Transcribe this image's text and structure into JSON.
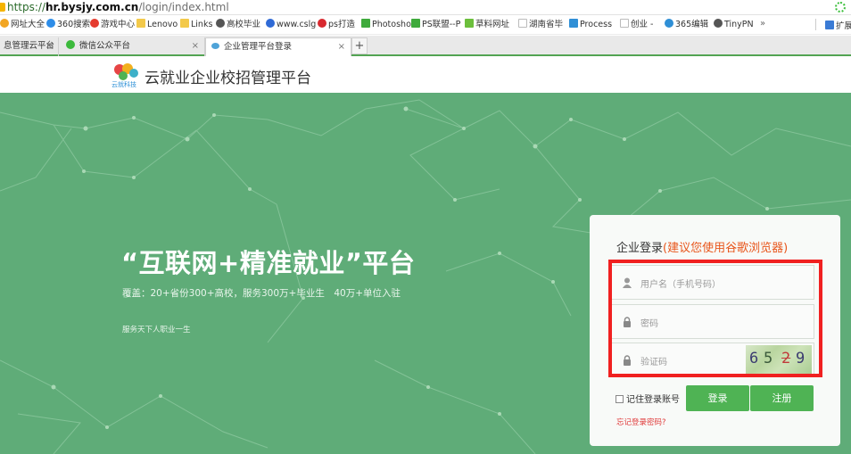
{
  "browser": {
    "url_scheme": "https://",
    "url_host": "hr.bysjy.com.cn",
    "url_path": "/login/index.html"
  },
  "bookmarks": [
    {
      "label": "网址大全",
      "color": "#f2a623"
    },
    {
      "label": "360搜索",
      "color": "#2e8de8"
    },
    {
      "label": "游戏中心",
      "color": "#e53b2f"
    },
    {
      "label": "Lenovo",
      "color": "#f3c94a"
    },
    {
      "label": "Links",
      "color": "#f3c94a"
    },
    {
      "label": "高校毕业",
      "color": "#555555"
    },
    {
      "label": "www.cslg",
      "color": "#2f6ad6"
    },
    {
      "label": "ps打造",
      "color": "#d8292f"
    },
    {
      "label": "Photosho",
      "color": "#3faa3c"
    },
    {
      "label": "PS联盟--P",
      "color": "#3faa3c"
    },
    {
      "label": "草料网址",
      "color": "#6cbf3c"
    },
    {
      "label": "湖南省毕",
      "color": "#bbbbbb"
    },
    {
      "label": "Process",
      "color": "#2f8fd6"
    },
    {
      "label": "创业 -",
      "color": "#bbbbbb"
    },
    {
      "label": "365编辑",
      "color": "#2f8fd6"
    },
    {
      "label": "TinyPN",
      "color": "#555555"
    }
  ],
  "bookmarks_more": "»",
  "bookmarks_right": "扩展",
  "tabs": [
    {
      "label": "息管理云平台",
      "active": false
    },
    {
      "label": "微信公众平台",
      "active": false
    },
    {
      "label": "企业管理平台登录",
      "active": true
    }
  ],
  "tab_close": "×",
  "tab_new": "+",
  "site": {
    "logo_text": "云就科技",
    "title": "云就业企业校招管理平台"
  },
  "hero": {
    "title": "“互联网+精准就业”平台",
    "subtitle": "覆盖：20+省份300+高校，服务300万+毕业生　40万+单位入驻",
    "motto": "服务天下人职业一生"
  },
  "login": {
    "title": "企业登录",
    "title_hint": "(建议您使用谷歌浏览器)",
    "username_placeholder": "用户名（手机号码）",
    "password_placeholder": "密码",
    "captcha_placeholder": "验证码",
    "captcha_chars": [
      "6",
      "5",
      "2",
      "9"
    ],
    "remember_label": "记住登录账号",
    "login_button": "登录",
    "register_button": "注册",
    "forgot_link": "忘记登录密码?"
  },
  "colors": {
    "hero_bg": "#5fac78",
    "button_green": "#4fb354",
    "hint_orange": "#e8561c",
    "highlight_red": "#f02020"
  },
  "icons": [
    "lock-icon",
    "extension-icon",
    "user-icon",
    "password-lock-icon",
    "captcha-lock-icon",
    "tab-favicon"
  ]
}
